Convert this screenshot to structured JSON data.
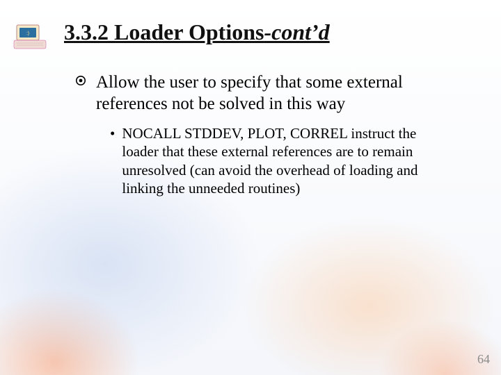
{
  "title": {
    "main": "3.3.2 Loader Options",
    "suffix": "-cont’d"
  },
  "body": {
    "level1_text": "Allow the user to specify that some external references not be solved in this way",
    "level2_bullet": "•",
    "level2_text": "NOCALL  STDDEV, PLOT, CORREL instruct the loader that these external references are to remain unresolved (can avoid the overhead of loading and linking the unneeded routines)"
  },
  "page_number": "64",
  "icons": {
    "corner": "computer-icon",
    "bullet1": "circled-dot-icon"
  }
}
